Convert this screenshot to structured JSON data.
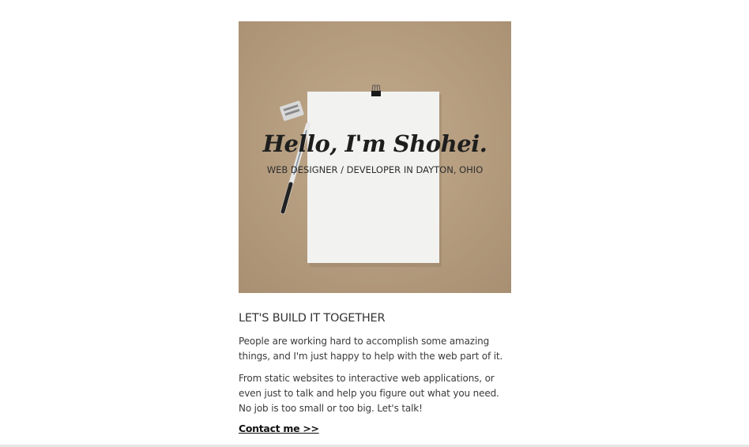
{
  "hero": {
    "title": "Hello, I'm Shohei.",
    "subtitle": "WEB DESIGNER / DEVELOPER IN DAYTON, OHIO",
    "background_color": "#b79e80",
    "paper_color": "#f2f2f0"
  },
  "about": {
    "heading": "LET'S BUILD IT TOGETHER",
    "paragraphs": [
      "People are working hard to accomplish some amazing things, and I'm just happy to help with the web part of it.",
      "From static websites to interactive web applications, or even just to talk and help you figure out what you need. No job is too small or too big. Let's talk!"
    ],
    "contact_link": "Contact me >>"
  }
}
